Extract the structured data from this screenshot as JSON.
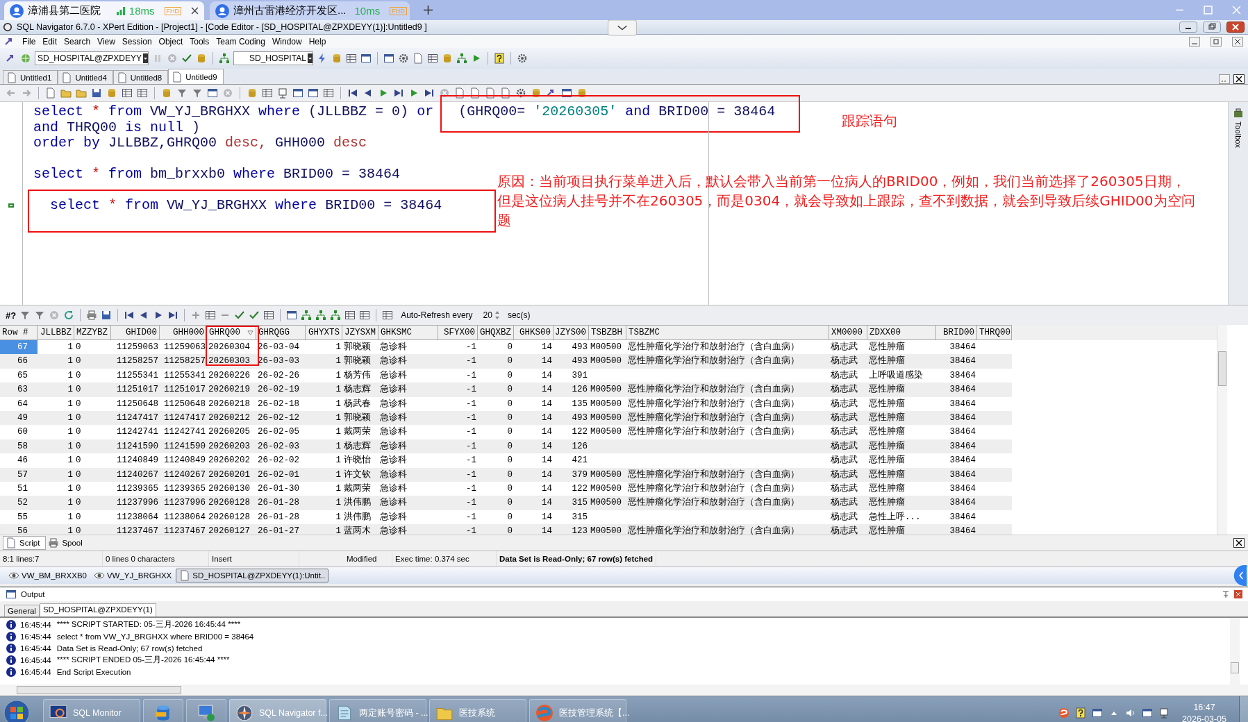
{
  "browser_tabs": [
    {
      "title": "漳浦县第二医院",
      "ping": "18ms",
      "badge": "FHD",
      "selected": true
    },
    {
      "title": "漳州古雷港经济开发区...",
      "ping": "10ms",
      "badge": "FHD",
      "selected": false
    }
  ],
  "window": {
    "title": "SQL Navigator 6.7.0 - XPert Edition - [Project1] - [Code Editor - [SD_HOSPITAL@ZPXDEYY(1)]:Untitled9 ]"
  },
  "menu": [
    "File",
    "Edit",
    "Search",
    "View",
    "Session",
    "Object",
    "Tools",
    "Team Coding",
    "Window",
    "Help"
  ],
  "toolbar": {
    "connection": "SD_HOSPITAL@ZPXDEYY",
    "schema": "SD_HOSPITAL"
  },
  "editor_tabs": [
    {
      "label": "Untitled1",
      "selected": false
    },
    {
      "label": "Untitled4",
      "selected": false
    },
    {
      "label": "Untitled8",
      "selected": false
    },
    {
      "label": "Untitled9",
      "selected": true
    }
  ],
  "editor": {
    "side_tab": "Toolbox",
    "lines": [
      {
        "kind": "code",
        "current": false,
        "tokens": [
          {
            "text": "select",
            "kind": "keyword"
          },
          {
            "text": "*",
            "kind": "operator"
          },
          {
            "text": "from",
            "kind": "keyword"
          },
          {
            "text": "VW_YJ_BRGHXX",
            "kind": "identifier"
          },
          {
            "text": "where",
            "kind": "keyword"
          },
          {
            "text": "(JLLBBZ = 0)",
            "kind": "identifier"
          },
          {
            "text": "or",
            "kind": "keyword"
          }
        ],
        "boxed_tokens": [
          {
            "text": "(GHRQ00=",
            "kind": "identifier"
          },
          {
            "text": "'20260305'",
            "kind": "string"
          },
          {
            "text": "and",
            "kind": "keyword"
          },
          {
            "text": "BRID00 = 38464",
            "kind": "identifier"
          }
        ]
      },
      {
        "kind": "code",
        "current": false,
        "tokens": [
          {
            "text": "and",
            "kind": "keyword"
          },
          {
            "text": "THRQ00",
            "kind": "identifier"
          },
          {
            "text": "is null",
            "kind": "keyword"
          },
          {
            "text": ")",
            "kind": "identifier"
          }
        ]
      },
      {
        "kind": "code",
        "current": false,
        "tokens": [
          {
            "text": "order by",
            "kind": "keyword"
          },
          {
            "text": "JLLBBZ,GHRQ00",
            "kind": "identifier"
          },
          {
            "text": "desc,",
            "kind": "order"
          },
          {
            "text": "GHH000",
            "kind": "identifier"
          },
          {
            "text": "desc",
            "kind": "order"
          }
        ]
      },
      {
        "kind": "blank",
        "current": false
      },
      {
        "kind": "code",
        "current": false,
        "tokens": [
          {
            "text": "select",
            "kind": "keyword"
          },
          {
            "text": "*",
            "kind": "operator"
          },
          {
            "text": "from",
            "kind": "keyword"
          },
          {
            "text": "bm_brxxb0",
            "kind": "identifier"
          },
          {
            "text": "where",
            "kind": "keyword"
          },
          {
            "text": "BRID00 = 38464",
            "kind": "identifier"
          }
        ]
      },
      {
        "kind": "blank",
        "current": false
      },
      {
        "kind": "code",
        "current": true,
        "boxed_tokens": [
          {
            "text": "select",
            "kind": "keyword"
          },
          {
            "text": "*",
            "kind": "operator"
          },
          {
            "text": "from",
            "kind": "keyword"
          },
          {
            "text": "VW_YJ_BRGHXX",
            "kind": "identifier"
          },
          {
            "text": "where",
            "kind": "keyword"
          },
          {
            "text": "BRID00 = 38464",
            "kind": "identifier"
          }
        ]
      }
    ],
    "annotation_label": "跟踪语句",
    "annotation_note": "原因：当前项目执行菜单进入后，默认会带入当前第一位病人的BRID00，例如，我们当前选择了260305日期，但是这位病人挂号并不在260305，而是0304，就会导致如上跟踪，查不到数据，就会到导致后续GHID00为空问题"
  },
  "grid_toolbar": {
    "query_label": "#?",
    "auto_refresh_label": "Auto-Refresh every",
    "interval": "20",
    "unit": "sec(s)"
  },
  "grid": {
    "columns": [
      {
        "label": "Row #",
        "sorted": false,
        "boxed": false
      },
      {
        "label": "JLLBBZ",
        "sorted": false,
        "boxed": false
      },
      {
        "label": "MZZYBZ",
        "sorted": false,
        "boxed": false
      },
      {
        "label": "GHID00",
        "sorted": false,
        "boxed": false
      },
      {
        "label": "GHH000",
        "sorted": false,
        "boxed": false
      },
      {
        "label": "GHRQ00",
        "sorted": true,
        "boxed": true
      },
      {
        "label": "GHRQGG",
        "sorted": false,
        "boxed": false
      },
      {
        "label": "GHYXTS",
        "sorted": false,
        "boxed": false
      },
      {
        "label": "JZYSXM",
        "sorted": false,
        "boxed": false
      },
      {
        "label": "GHKSMC",
        "sorted": false,
        "boxed": false
      },
      {
        "label": "SFYX00",
        "sorted": false,
        "boxed": false
      },
      {
        "label": "GHQXBZ",
        "sorted": false,
        "boxed": false
      },
      {
        "label": "GHKS00",
        "sorted": false,
        "boxed": false
      },
      {
        "label": "JZYS00",
        "sorted": false,
        "boxed": false
      },
      {
        "label": "TSBZBH",
        "sorted": false,
        "boxed": false
      },
      {
        "label": "TSBZMC",
        "sorted": false,
        "boxed": false
      },
      {
        "label": "XM0000",
        "sorted": false,
        "boxed": false
      },
      {
        "label": "ZDXX00",
        "sorted": false,
        "boxed": false
      },
      {
        "label": "BRID00",
        "sorted": false,
        "boxed": false
      },
      {
        "label": "THRQ00",
        "sorted": false,
        "boxed": false
      }
    ],
    "rows": [
      {
        "selected": true,
        "cells": [
          "67",
          "1",
          "0",
          "11259063",
          "11259063",
          "20260304",
          "26-03-04",
          "1",
          "郭晓颖",
          "急诊科",
          "-1",
          "0",
          "14",
          "493",
          "M00500",
          "恶性肿瘤化学治疗和放射治疗（含白血病）",
          "杨志武",
          "恶性肿瘤",
          "38464",
          ""
        ]
      },
      {
        "selected": false,
        "cells": [
          "66",
          "1",
          "0",
          "11258257",
          "11258257",
          "20260303",
          "26-03-03",
          "1",
          "郭晓颖",
          "急诊科",
          "-1",
          "0",
          "14",
          "493",
          "M00500",
          "恶性肿瘤化学治疗和放射治疗（含白血病）",
          "杨志武",
          "恶性肿瘤",
          "38464",
          ""
        ]
      },
      {
        "selected": false,
        "cells": [
          "65",
          "1",
          "0",
          "11255341",
          "11255341",
          "20260226",
          "26-02-26",
          "1",
          "杨芳伟",
          "急诊科",
          "-1",
          "0",
          "14",
          "391",
          "",
          "",
          "杨志武",
          "上呼吸道感染",
          "38464",
          ""
        ]
      },
      {
        "selected": false,
        "cells": [
          "63",
          "1",
          "0",
          "11251017",
          "11251017",
          "20260219",
          "26-02-19",
          "1",
          "杨志辉",
          "急诊科",
          "-1",
          "0",
          "14",
          "126",
          "M00500",
          "恶性肿瘤化学治疗和放射治疗（含白血病）",
          "杨志武",
          "恶性肿瘤",
          "38464",
          ""
        ]
      },
      {
        "selected": false,
        "cells": [
          "64",
          "1",
          "0",
          "11250648",
          "11250648",
          "20260218",
          "26-02-18",
          "1",
          "杨武春",
          "急诊科",
          "-1",
          "0",
          "14",
          "135",
          "M00500",
          "恶性肿瘤化学治疗和放射治疗（含白血病）",
          "杨志武",
          "恶性肿瘤",
          "38464",
          ""
        ]
      },
      {
        "selected": false,
        "cells": [
          "49",
          "1",
          "0",
          "11247417",
          "11247417",
          "20260212",
          "26-02-12",
          "1",
          "郭晓颖",
          "急诊科",
          "-1",
          "0",
          "14",
          "493",
          "M00500",
          "恶性肿瘤化学治疗和放射治疗（含白血病）",
          "杨志武",
          "恶性肿瘤",
          "38464",
          ""
        ]
      },
      {
        "selected": false,
        "cells": [
          "60",
          "1",
          "0",
          "11242741",
          "11242741",
          "20260205",
          "26-02-05",
          "1",
          "戴两荣",
          "急诊科",
          "-1",
          "0",
          "14",
          "122",
          "M00500",
          "恶性肿瘤化学治疗和放射治疗（含白血病）",
          "杨志武",
          "恶性肿瘤",
          "38464",
          ""
        ]
      },
      {
        "selected": false,
        "cells": [
          "58",
          "1",
          "0",
          "11241590",
          "11241590",
          "20260203",
          "26-02-03",
          "1",
          "杨志辉",
          "急诊科",
          "-1",
          "0",
          "14",
          "126",
          "",
          "",
          "杨志武",
          "恶性肿瘤",
          "38464",
          ""
        ]
      },
      {
        "selected": false,
        "cells": [
          "46",
          "1",
          "0",
          "11240849",
          "11240849",
          "20260202",
          "26-02-02",
          "1",
          "许晓怡",
          "急诊科",
          "-1",
          "0",
          "14",
          "421",
          "",
          "",
          "杨志武",
          "恶性肿瘤",
          "38464",
          ""
        ]
      },
      {
        "selected": false,
        "cells": [
          "57",
          "1",
          "0",
          "11240267",
          "11240267",
          "20260201",
          "26-02-01",
          "1",
          "许文钦",
          "急诊科",
          "-1",
          "0",
          "14",
          "379",
          "M00500",
          "恶性肿瘤化学治疗和放射治疗（含白血病）",
          "杨志武",
          "恶性肿瘤",
          "38464",
          ""
        ]
      },
      {
        "selected": false,
        "cells": [
          "51",
          "1",
          "0",
          "11239365",
          "11239365",
          "20260130",
          "26-01-30",
          "1",
          "戴两荣",
          "急诊科",
          "-1",
          "0",
          "14",
          "122",
          "M00500",
          "恶性肿瘤化学治疗和放射治疗（含白血病）",
          "杨志武",
          "恶性肿瘤",
          "38464",
          ""
        ]
      },
      {
        "selected": false,
        "cells": [
          "52",
          "1",
          "0",
          "11237996",
          "11237996",
          "20260128",
          "26-01-28",
          "1",
          "洪伟鹏",
          "急诊科",
          "-1",
          "0",
          "14",
          "315",
          "M00500",
          "恶性肿瘤化学治疗和放射治疗（含白血病）",
          "杨志武",
          "恶性肿瘤",
          "38464",
          ""
        ]
      },
      {
        "selected": false,
        "cells": [
          "55",
          "1",
          "0",
          "11238064",
          "11238064",
          "20260128",
          "26-01-28",
          "1",
          "洪伟鹏",
          "急诊科",
          "-1",
          "0",
          "14",
          "315",
          "",
          "",
          "杨志武",
          "急性上呼...",
          "38464",
          ""
        ]
      },
      {
        "selected": false,
        "cells": [
          "56",
          "1",
          "0",
          "11237467",
          "11237467",
          "20260127",
          "26-01-27",
          "1",
          "蓝两木",
          "急诊科",
          "-1",
          "0",
          "14",
          "123",
          "M00500",
          "恶性肿瘤化学治疗和放射治疗（含白血病）",
          "杨志武",
          "恶性肿瘤",
          "38464",
          ""
        ]
      }
    ]
  },
  "result_tabs": [
    {
      "label": "Script",
      "selected": true
    },
    {
      "label": "Spool",
      "selected": false
    }
  ],
  "status_bar": [
    {
      "text": "8:1 lines:7",
      "bold": false
    },
    {
      "text": "0 lines 0 characters",
      "bold": false
    },
    {
      "text": "Insert",
      "bold": false
    },
    {
      "text": "Modified",
      "bold": false
    },
    {
      "text": "Exec time: 0.374 sec",
      "bold": false
    },
    {
      "text": "Data Set is Read-Only; 67 row(s) fetched",
      "bold": true
    }
  ],
  "document_tabs": [
    {
      "label": "VW_BM_BRXXB0",
      "selected": false
    },
    {
      "label": "VW_YJ_BRGHXX",
      "selected": false
    },
    {
      "label": "SD_HOSPITAL@ZPXDEYY(1):Untit..",
      "selected": true
    }
  ],
  "output": {
    "title": "Output",
    "tabs": [
      {
        "label": "General",
        "selected": false
      },
      {
        "label": "SD_HOSPITAL@ZPXDEYY(1)",
        "selected": true
      }
    ],
    "log": [
      {
        "time": "16:45:44",
        "message": "**** SCRIPT STARTED: 05-三月-2026 16:45:44 ****"
      },
      {
        "time": "16:45:44",
        "message": "select * from VW_YJ_BRGHXX where BRID00 = 38464"
      },
      {
        "time": "16:45:44",
        "message": "Data Set is Read-Only; 67 row(s) fetched"
      },
      {
        "time": "16:45:44",
        "message": "**** SCRIPT ENDED 05-三月-2026 16:45:44 ****"
      },
      {
        "time": "16:45:44",
        "message": "End Script Execution"
      }
    ]
  },
  "taskbar": {
    "items": [
      {
        "kind": "monitor",
        "label": "SQL Monitor",
        "active": false
      },
      {
        "kind": "database",
        "active": false
      },
      {
        "kind": "remote",
        "active": false
      },
      {
        "kind": "compass",
        "label": "SQL Navigator f...",
        "active": true
      },
      {
        "kind": "notepad",
        "label": "两定账号密码 - ...",
        "active": false
      },
      {
        "kind": "folder",
        "label": "医技系统",
        "active": false
      },
      {
        "kind": "swirl",
        "label": "医技管理系统【...",
        "active": false
      }
    ],
    "time": "16:47",
    "date": "2026-03-05"
  }
}
